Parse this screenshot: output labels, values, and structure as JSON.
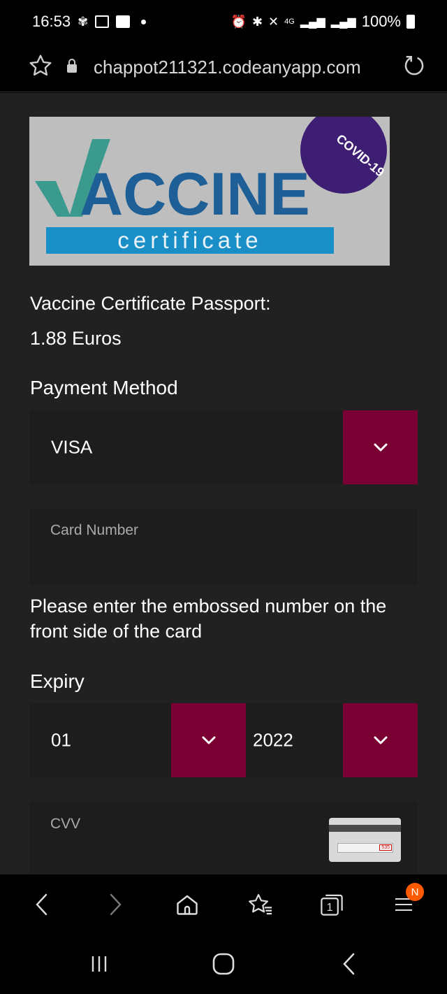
{
  "status_bar": {
    "time": "16:53",
    "network": "4G",
    "battery": "100%",
    "icons": [
      "pinwheel-icon",
      "gallery-icon",
      "tiktok-icon",
      "notification-dot",
      "alarm-icon",
      "bluetooth-icon",
      "mute-icon",
      "signal-icon",
      "signal-icon",
      "battery-icon"
    ]
  },
  "url_bar": {
    "url": "chappot211321.codeanyapp.com",
    "icons": [
      "star-icon",
      "lock-icon",
      "reload-icon"
    ]
  },
  "banner": {
    "title": "ACCINE",
    "subtitle": "certificate",
    "badge": "COVID-19",
    "colors": {
      "check": "#3b9a8e",
      "title": "#1d5f96",
      "subtitle_bg": "#1a8fc7",
      "badge": "#3d1e72",
      "bg": "#bebebe"
    }
  },
  "product": {
    "label": "Vaccine Certificate Passport:",
    "price": "1.88 Euros"
  },
  "payment": {
    "label": "Payment Method",
    "selected": "VISA",
    "card_placeholder": "Card Number",
    "hint": "Please enter the embossed number on the front side of the card"
  },
  "expiry": {
    "label": "Expiry",
    "month": "01",
    "year": "2022"
  },
  "cvv": {
    "placeholder": "CVV",
    "card_code": "535"
  },
  "browser_toolbar": {
    "badge": "N",
    "tabs_count": "1",
    "icons": [
      "back-icon",
      "forward-icon",
      "home-icon",
      "bookmarks-icon",
      "tabs-icon",
      "menu-icon"
    ]
  },
  "nav_bar": {
    "icons": [
      "recents-icon",
      "home-icon",
      "back-icon"
    ]
  },
  "colors": {
    "accent": "#7a0033",
    "page_bg": "#212121",
    "field_bg": "#1d1d1d"
  }
}
